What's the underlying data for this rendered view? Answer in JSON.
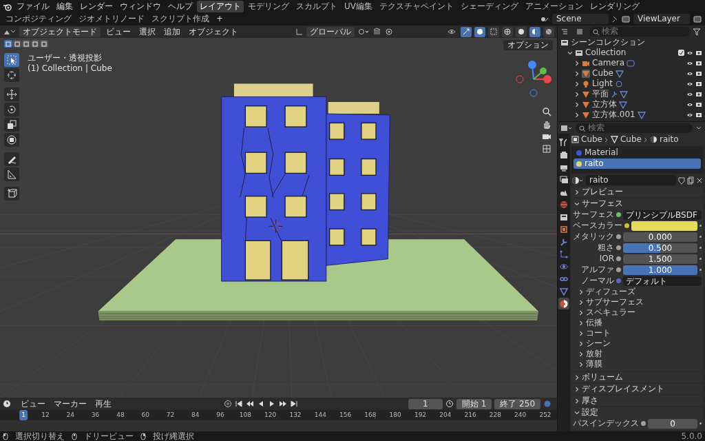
{
  "topbar": {
    "menus": [
      "ファイル",
      "編集",
      "レンダー",
      "ウィンドウ",
      "ヘルプ"
    ],
    "workspaces": [
      {
        "label": "レイアウト",
        "selected": true
      },
      {
        "label": "モデリング",
        "selected": false
      },
      {
        "label": "スカルプト",
        "selected": false
      },
      {
        "label": "UV編集",
        "selected": false
      },
      {
        "label": "テクスチャペイント",
        "selected": false
      },
      {
        "label": "シェーディング",
        "selected": false
      },
      {
        "label": "アニメーション",
        "selected": false
      },
      {
        "label": "レンダリング",
        "selected": false
      },
      {
        "label": "コンポジティング",
        "selected": false
      },
      {
        "label": "ジオメトリノード",
        "selected": false
      },
      {
        "label": "スクリプト作成",
        "selected": false
      }
    ],
    "add_workspace": "+",
    "scene": "Scene",
    "view_layer": "ViewLayer"
  },
  "viewport": {
    "mode": "オブジェクトモード",
    "editor_menus": [
      "ビュー",
      "選択",
      "追加",
      "オブジェクト"
    ],
    "orientation": "グローバル",
    "options": "オプション",
    "select_modes": [
      {
        "selected": true
      },
      {
        "selected": false
      },
      {
        "selected": false
      },
      {
        "selected": false
      },
      {
        "selected": false
      }
    ],
    "shading_modes": [
      {
        "kind": "wireframe",
        "selected": false
      },
      {
        "kind": "solid",
        "selected": false
      },
      {
        "kind": "material",
        "selected": true
      },
      {
        "kind": "rendered",
        "selected": false
      }
    ],
    "view_name": "ユーザー・透視投影",
    "context": "(1) Collection | Cube",
    "tools": [
      {
        "kind": "select",
        "selected": true
      },
      {
        "kind": "cursor",
        "selected": false
      },
      {
        "kind": "move",
        "selected": false
      },
      {
        "kind": "rotate",
        "selected": false
      },
      {
        "kind": "scale",
        "selected": false
      },
      {
        "kind": "transform",
        "selected": false
      },
      {
        "kind": "annotate",
        "selected": false
      },
      {
        "kind": "measure",
        "selected": false
      },
      {
        "kind": "add_cube",
        "selected": false
      }
    ]
  },
  "outliner": {
    "search": {
      "placeholder": "検索"
    },
    "tree": [
      {
        "name": "シーンコレクション",
        "kind": "scene_collection",
        "children": [
          {
            "name": "Collection",
            "kind": "collection",
            "expanded": true,
            "checked": true,
            "children": [
              {
                "name": "Camera",
                "kind": "camera",
                "expanded": false,
                "active": false,
                "has_modifier": false
              },
              {
                "name": "Cube",
                "kind": "mesh",
                "expanded": false,
                "active": true,
                "has_modifier": false
              },
              {
                "name": "Light",
                "kind": "light",
                "expanded": false,
                "active": false,
                "has_modifier": false
              },
              {
                "name": "平面",
                "kind": "mesh",
                "expanded": false,
                "active": false,
                "has_modifier": true
              },
              {
                "name": "立方体",
                "kind": "mesh",
                "expanded": false,
                "active": false,
                "has_modifier": false
              },
              {
                "name": "立方体.001",
                "kind": "mesh",
                "expanded": false,
                "active": false,
                "has_modifier": false
              }
            ]
          }
        ]
      }
    ]
  },
  "properties": {
    "search": {
      "placeholder": "検索"
    },
    "tabs": [
      {
        "kind": "tool",
        "selected": false
      },
      {
        "kind": "render",
        "selected": false
      },
      {
        "kind": "output",
        "selected": false
      },
      {
        "kind": "view_layer",
        "selected": false
      },
      {
        "kind": "scene",
        "selected": false
      },
      {
        "kind": "world",
        "selected": false
      },
      {
        "kind": "collection",
        "selected": false
      },
      {
        "kind": "object",
        "selected": false
      },
      {
        "kind": "modifier",
        "selected": false
      },
      {
        "kind": "particles",
        "selected": false
      },
      {
        "kind": "physics",
        "selected": false
      },
      {
        "kind": "constraints",
        "selected": false
      },
      {
        "kind": "data",
        "selected": false
      },
      {
        "kind": "material",
        "selected": true
      }
    ],
    "breadcrumb": [
      "Cube",
      "Cube",
      "raito"
    ],
    "material_slots": [
      {
        "name": "Material",
        "color": "#3d52d6",
        "selected": false
      },
      {
        "name": "raito",
        "color": "#e3d36a",
        "selected": true
      }
    ],
    "material_name": "raito",
    "panels": [
      {
        "title": "プレビュー",
        "expanded": false
      },
      {
        "title": "サーフェス",
        "expanded": true,
        "fields": [
          {
            "label": "サーフェス",
            "kind": "shader",
            "value": "プリンシプルBSDF"
          },
          {
            "label": "ベースカラー",
            "kind": "color",
            "color": "#e6dc5a"
          },
          {
            "label": "メタリック",
            "kind": "slider",
            "value": "0.000",
            "level": 0
          },
          {
            "label": "粗さ",
            "kind": "slider",
            "value": "0.500",
            "level": 0.5
          },
          {
            "label": "IOR",
            "kind": "number",
            "value": "1.500"
          },
          {
            "label": "アルファ",
            "kind": "slider",
            "value": "1.000",
            "level": 1
          },
          {
            "label": "ノーマル",
            "kind": "link",
            "value": "デフォルト"
          }
        ],
        "subpanels": [
          {
            "title": "ディフューズ",
            "expanded": false
          },
          {
            "title": "サブサーフェス",
            "expanded": false
          },
          {
            "title": "スペキュラー",
            "expanded": false
          },
          {
            "title": "伝播",
            "expanded": false
          },
          {
            "title": "コート",
            "expanded": false
          },
          {
            "title": "シーン",
            "expanded": false
          },
          {
            "title": "放射",
            "expanded": false
          },
          {
            "title": "薄膜",
            "expanded": false
          }
        ]
      },
      {
        "title": "ボリューム",
        "expanded": false
      },
      {
        "title": "ディスプレイスメント",
        "expanded": false
      },
      {
        "title": "厚さ",
        "expanded": false
      },
      {
        "title": "設定",
        "expanded": true,
        "fields": [
          {
            "label": "パスインデックス",
            "kind": "number",
            "value": "0"
          }
        ]
      }
    ]
  },
  "timeline": {
    "menus": [
      "ビュー",
      "マーカー",
      "再生"
    ],
    "current_frame": "1",
    "start_label": "開始",
    "start": "1",
    "end_label": "終了",
    "end": "250",
    "playhead": "1",
    "ruler": [
      "12",
      "24",
      "36",
      "48",
      "60",
      "72",
      "84",
      "96",
      "108",
      "120",
      "132",
      "144",
      "156",
      "168",
      "180",
      "192",
      "204",
      "216",
      "228",
      "240",
      "252"
    ]
  },
  "status_bar": {
    "hints": [
      "選択切り替え",
      "ドリービュー",
      "投げ縄選択"
    ],
    "version": "5.0.0"
  }
}
